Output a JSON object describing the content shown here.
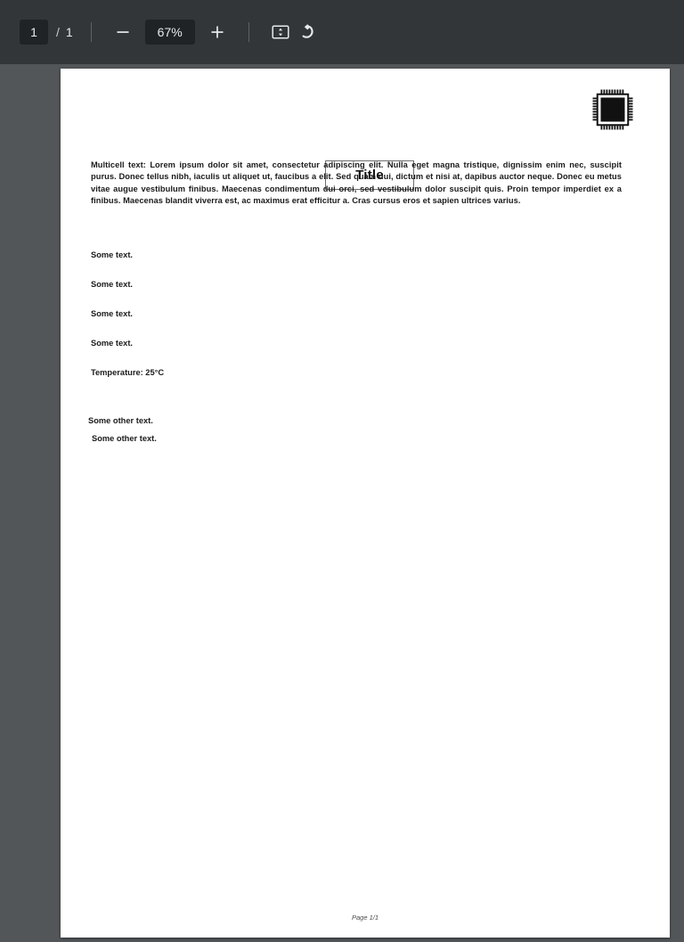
{
  "toolbar": {
    "page_number_value": "1",
    "page_separator": "/",
    "page_total": "1",
    "zoom_out_label": "−",
    "zoom_level": "67%",
    "zoom_in_label": "+",
    "fit_page_icon": "fit-to-page-icon",
    "rotate_icon": "rotate-counterclockwise-icon",
    "background_color": "#323639",
    "accent_field_color": "#1f2326",
    "text_color": "#e8eaed"
  },
  "viewer": {
    "background_color": "#525659",
    "page_background": "#ffffff"
  },
  "document": {
    "title": "Title",
    "logo_icon": "microchip-icon",
    "paragraph": "Multicell text: Lorem ipsum dolor sit amet, consectetur adipiscing elit. Nulla eget magna tristique, dignissim enim nec, suscipit purus. Donec tellus nibh, iaculis ut aliquet ut, faucibus a elit. Sed quam dui, dictum et nisi at, dapibus auctor neque. Donec eu metus vitae augue vestibulum finibus. Maecenas condimentum dui orci, sed vestibulum dolor suscipit quis. Proin tempor imperdiet ex a finibus. Maecenas blandit viverra est, ac maximus erat efficitur a. Cras cursus eros et sapien ultrices varius.",
    "lines": [
      "Some text.",
      "Some text.",
      "Some text.",
      "Some text.",
      "Temperature: 25°C"
    ],
    "other_lines": [
      "Some other text.",
      "Some other text."
    ],
    "footer": "Page 1/1"
  }
}
